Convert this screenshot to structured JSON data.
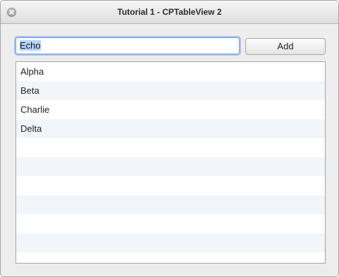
{
  "window": {
    "title": "Tutorial 1 - CPTableView 2"
  },
  "input": {
    "value": "Echo"
  },
  "toolbar": {
    "add_label": "Add"
  },
  "table": {
    "rows": [
      "Alpha",
      "Beta",
      "Charlie",
      "Delta",
      "",
      "",
      "",
      "",
      "",
      "",
      ""
    ]
  },
  "icons": {
    "close": "close-icon"
  }
}
